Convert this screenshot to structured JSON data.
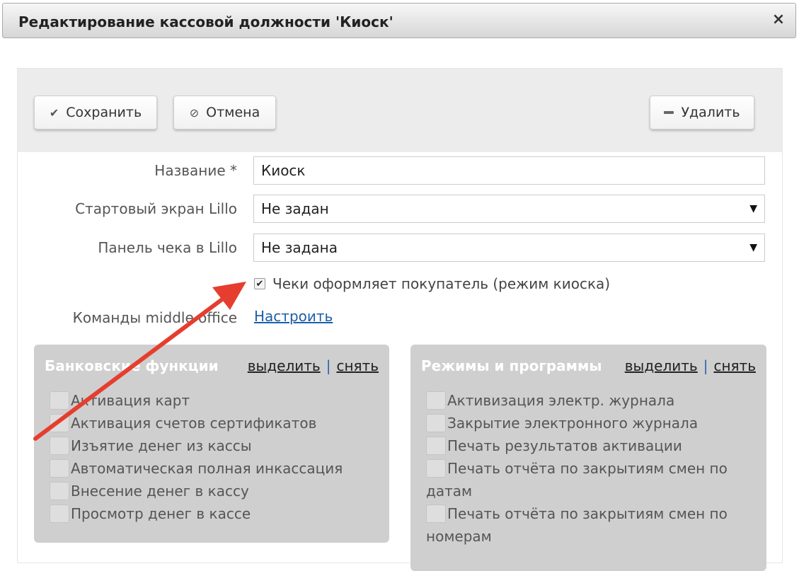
{
  "window": {
    "title": "Редактирование кассовой должности 'Киоск'",
    "close_label": "×"
  },
  "toolbar": {
    "save_label": "Сохранить",
    "cancel_label": "Отмена",
    "delete_label": "Удалить"
  },
  "icons": {
    "save": "check-icon",
    "cancel": "cancel-circle-icon",
    "delete": "minus-icon",
    "close": "close-icon"
  },
  "form": {
    "name_label": "Название *",
    "name_value": "Киоск",
    "start_screen_label": "Стартовый экран Lillo",
    "start_screen_value": "Не задан",
    "receipt_panel_label": "Панель чека в Lillo",
    "receipt_panel_value": "Не задана",
    "kiosk_checkbox_label": "Чеки оформляет покупатель (режим киоска)",
    "kiosk_checked": true,
    "commands_label": "Команды middle office",
    "commands_link": "Настроить"
  },
  "bank_group": {
    "title": "Банковские функции",
    "select_all": "выделить",
    "separator": "|",
    "clear_all": "снять",
    "items": [
      "Активация карт",
      "Активация счетов сертификатов",
      "Изъятие денег из кассы",
      "Автоматическая полная инкассация",
      "Внесение денег в кассу",
      "Просмотр денег в кассе"
    ]
  },
  "modes_group": {
    "title": "Режимы и программы",
    "select_all": "выделить",
    "separator": "|",
    "clear_all": "снять",
    "items": [
      "Активизация электр. журнала",
      "Закрытие электронного журнала",
      "Печать результатов активации",
      "Печать отчёта по закрытиям смен по датам",
      "Печать отчёта по закрытиям смен по номерам"
    ]
  },
  "colors": {
    "annotation_arrow": "#e53e2f",
    "link": "#1d5fa8",
    "group_bg": "#cfcfcf"
  }
}
